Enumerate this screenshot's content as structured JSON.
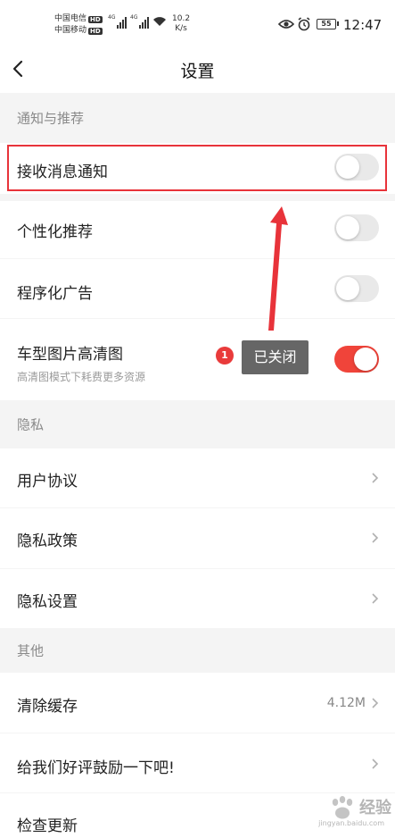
{
  "status_bar": {
    "carrier1": "中国电信",
    "carrier2": "中国移动",
    "hd": "HD",
    "net_tag": "4G",
    "net_speed": "10.2",
    "net_unit": "K/s",
    "battery": "55",
    "time": "12:47"
  },
  "header": {
    "title": "设置"
  },
  "sections": {
    "notify": "通知与推荐",
    "privacy": "隐私",
    "other": "其他"
  },
  "rows": {
    "receive_notify": {
      "label": "接收消息通知",
      "on": false
    },
    "personal_recommend": {
      "label": "个性化推荐",
      "on": false
    },
    "programmatic_ads": {
      "label": "程序化广告",
      "on": false
    },
    "hd_images": {
      "label": "车型图片高清图",
      "sub": "高清图模式下耗费更多资源",
      "on": true
    },
    "user_agreement": {
      "label": "用户协议"
    },
    "privacy_policy": {
      "label": "隐私政策"
    },
    "privacy_settings": {
      "label": "隐私设置"
    },
    "clear_cache": {
      "label": "清除缓存",
      "value": "4.12M"
    },
    "rate_us": {
      "label": "给我们好评鼓励一下吧!"
    },
    "check_update": {
      "label": "检查更新"
    }
  },
  "annotation": {
    "badge": "1",
    "tooltip": "已关闭"
  },
  "colors": {
    "accent": "#f0443a",
    "annotation": "#e8333a"
  },
  "watermark": {
    "text": "经验",
    "url": "jingyan.baidu.com"
  }
}
